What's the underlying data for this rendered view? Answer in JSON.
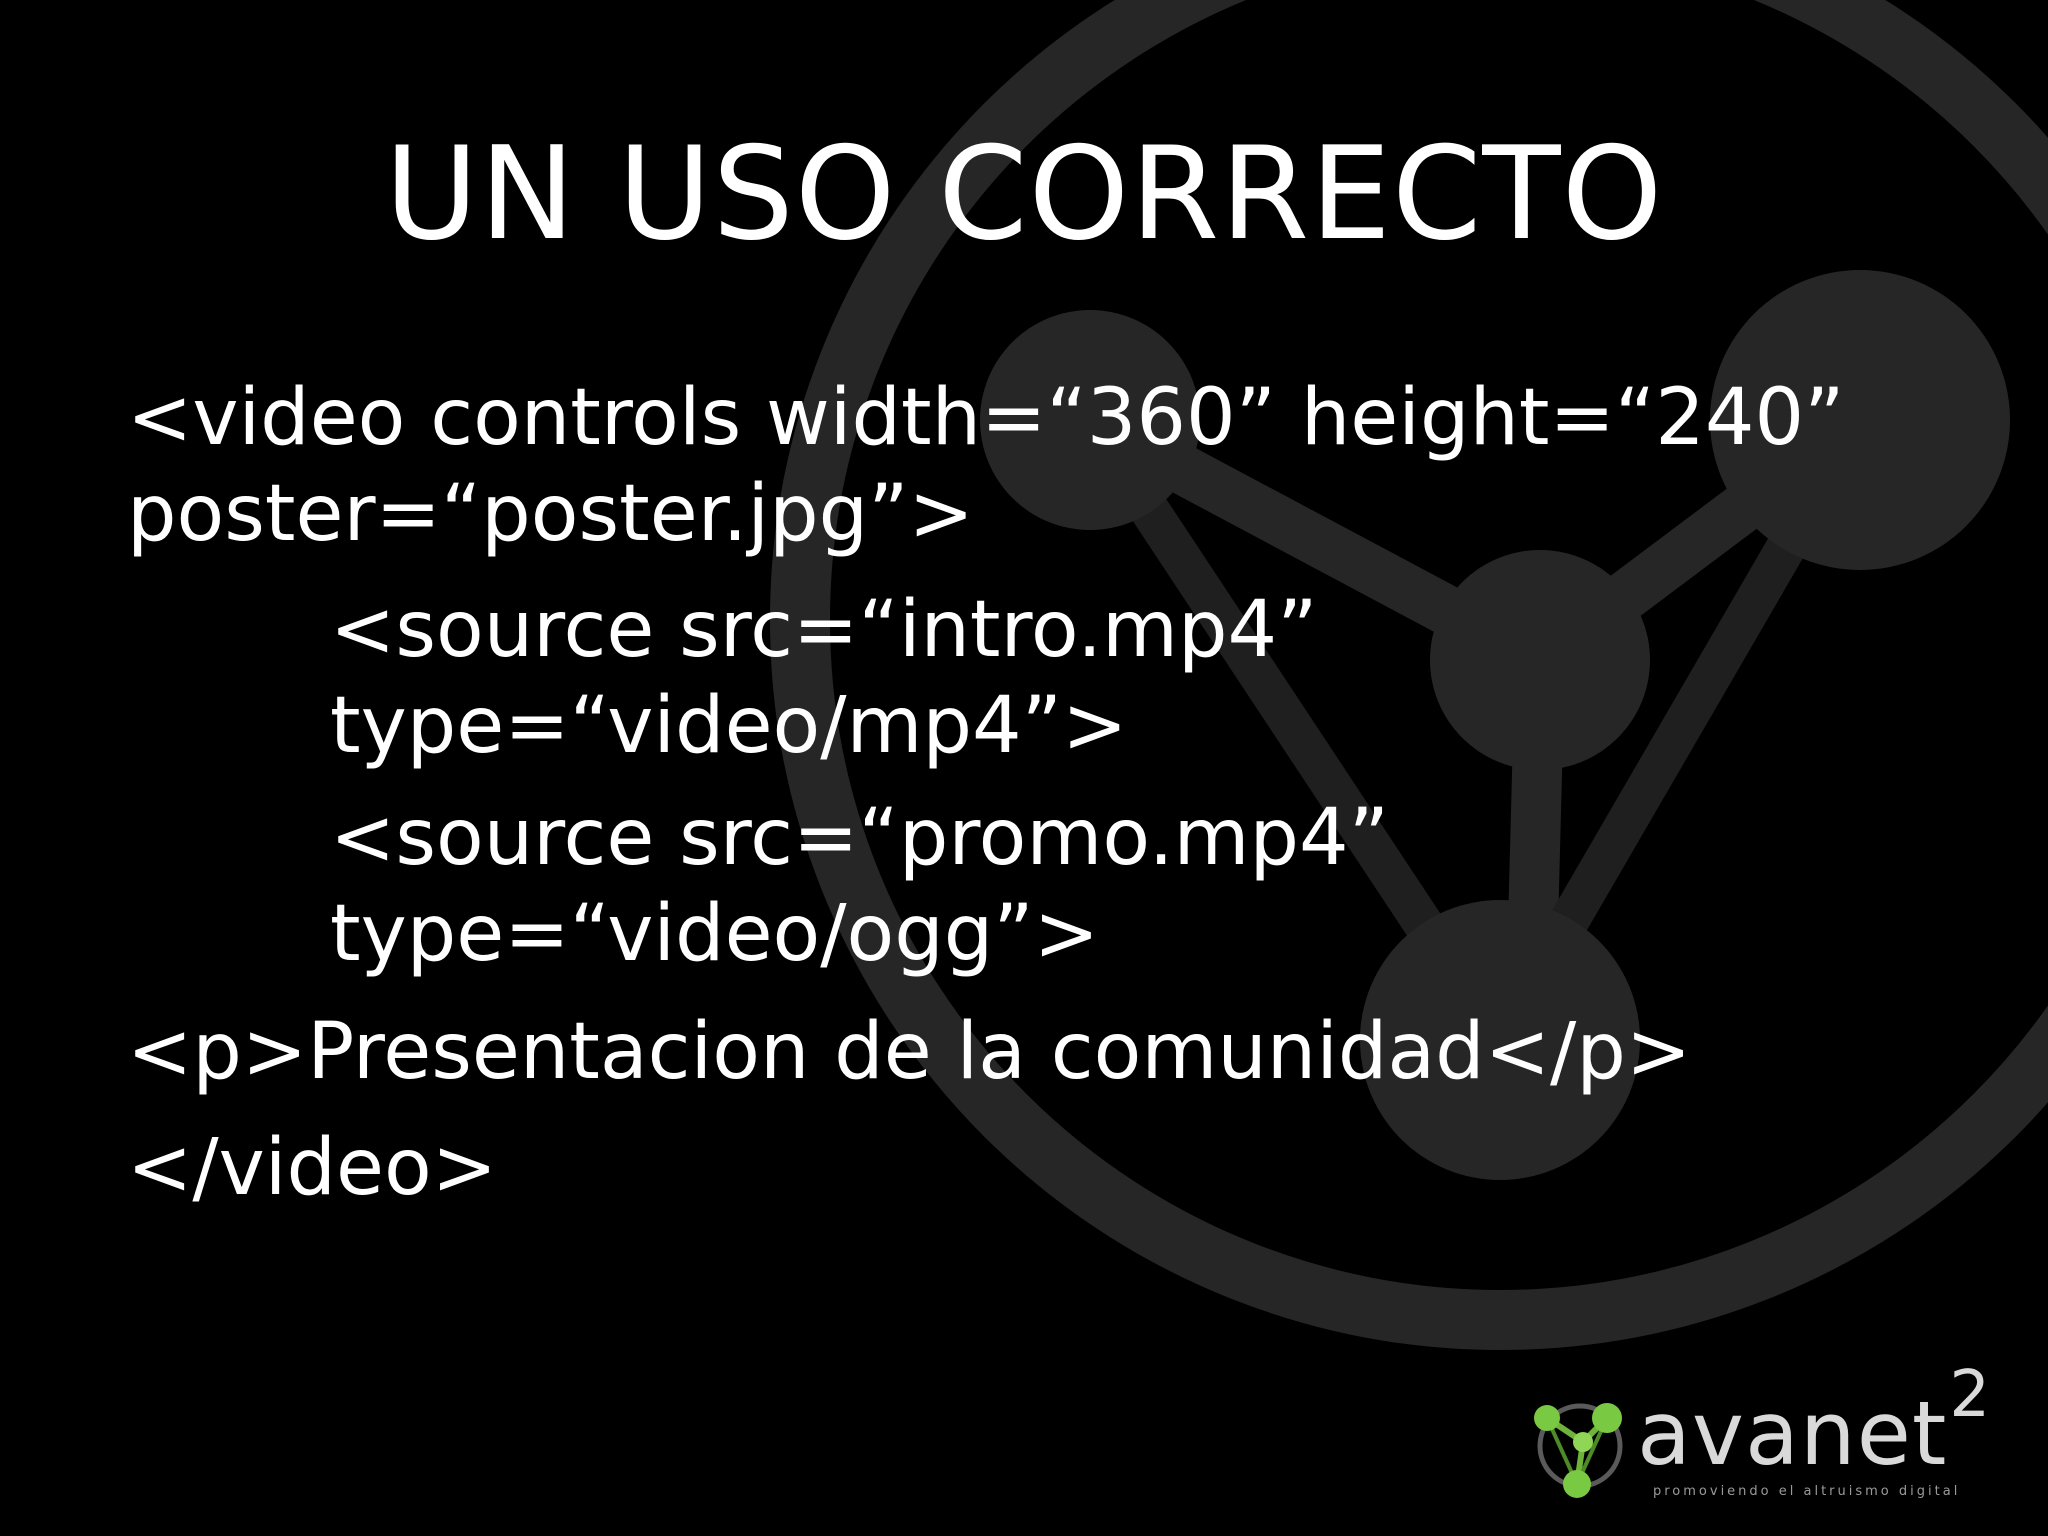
{
  "slide": {
    "title": "UN USO CORRECTO",
    "code_lines": [
      "<video controls width=“360” height=“240”",
      "poster=“poster.jpg”>",
      "<source src=“intro.mp4”",
      "type=“video/mp4”>",
      "<source src=“promo.mp4”",
      "type=“video/ogg”>",
      "<p>Presentacion de la comunidad</p>",
      "</video>"
    ]
  },
  "logo": {
    "word": "avanet",
    "superscript": "2",
    "tagline": "promoviendo el altruismo digital"
  },
  "colors": {
    "background": "#000000",
    "text": "#ffffff",
    "watermark": "#2a2a2a",
    "logo_green": "#7ac943"
  }
}
